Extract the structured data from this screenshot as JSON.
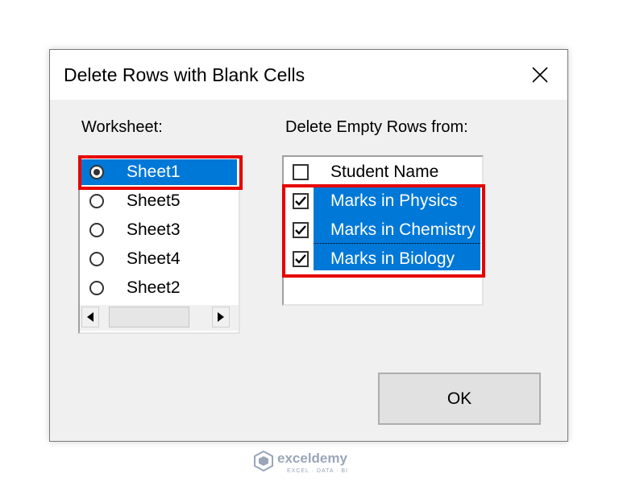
{
  "dialog": {
    "title": "Delete Rows with Blank Cells",
    "close_icon": "close-icon"
  },
  "worksheet": {
    "label": "Worksheet:",
    "options": [
      {
        "label": "Sheet1",
        "selected": true
      },
      {
        "label": "Sheet5",
        "selected": false
      },
      {
        "label": "Sheet3",
        "selected": false
      },
      {
        "label": "Sheet4",
        "selected": false
      },
      {
        "label": "Sheet2",
        "selected": false
      }
    ],
    "scroll_left_icon": "arrow-left-icon",
    "scroll_right_icon": "arrow-right-icon"
  },
  "columns": {
    "label": "Delete Empty Rows from:",
    "items": [
      {
        "label": "Student Name",
        "checked": false
      },
      {
        "label": "Marks in Physics",
        "checked": true
      },
      {
        "label": "Marks in Chemistry",
        "checked": true
      },
      {
        "label": "Marks in Biology",
        "checked": true
      }
    ]
  },
  "ok_label": "OK",
  "watermark": {
    "name": "exceldemy",
    "tagline": "EXCEL · DATA · BI"
  },
  "colors": {
    "selection": "#0078d7",
    "highlight_border": "#e60000",
    "dialog_bg": "#f0f0f0"
  }
}
